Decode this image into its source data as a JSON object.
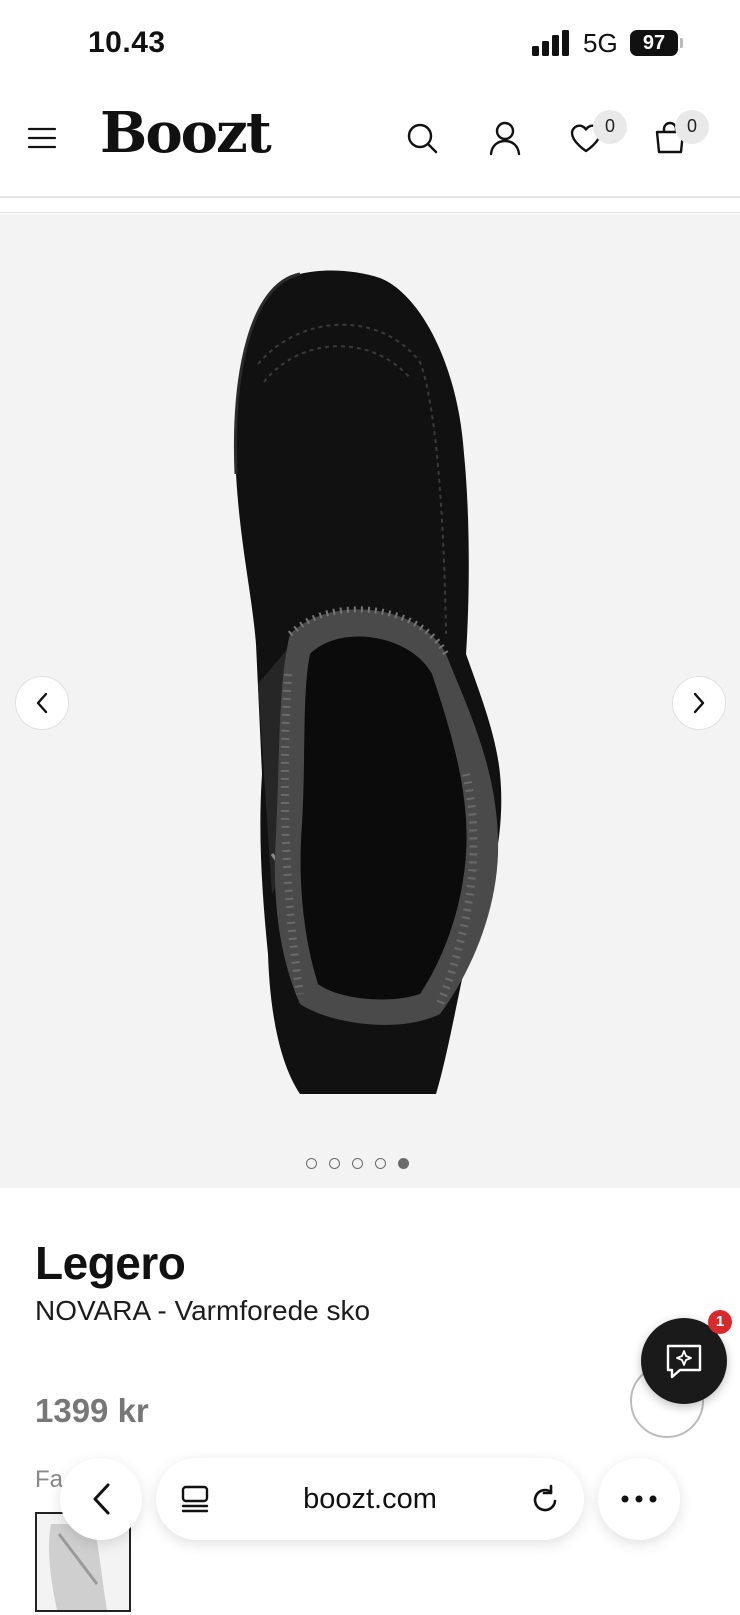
{
  "status_bar": {
    "time": "10.43",
    "network": "5G",
    "battery": "97"
  },
  "header": {
    "brand": "Boozt",
    "wishlist_count": "0",
    "cart_count": "0"
  },
  "gallery": {
    "image_count": 5,
    "active_index": 4
  },
  "product": {
    "brand": "Legero",
    "name": "NOVARA - Varmforede sko",
    "price": "1399 kr",
    "color_label": "Fa"
  },
  "chat": {
    "badge": "1"
  },
  "browser": {
    "url": "boozt.com"
  },
  "icons": {
    "menu": "hamburger-menu-icon",
    "search": "search-icon",
    "account": "user-icon",
    "wishlist": "heart-icon",
    "cart": "shopping-bag-icon",
    "prev": "chevron-left-icon",
    "next": "chevron-right-icon",
    "chat": "chat-sparkle-icon",
    "tabs": "tabs-icon",
    "reload": "reload-icon",
    "more": "more-icon"
  }
}
